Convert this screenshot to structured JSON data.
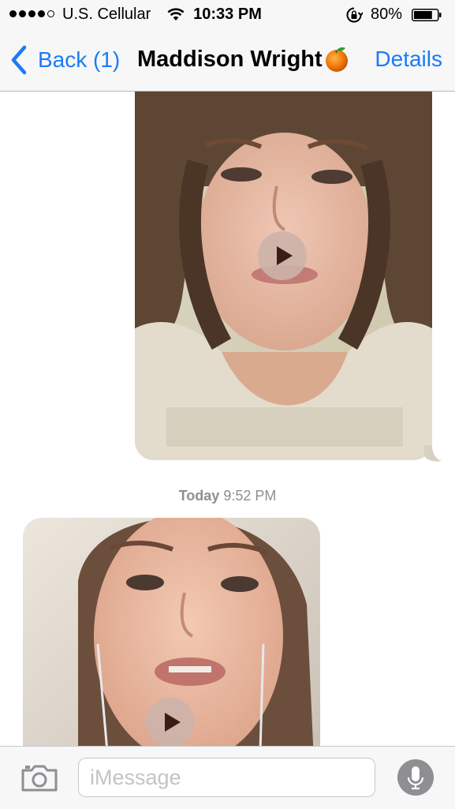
{
  "status_bar": {
    "carrier": "U.S. Cellular",
    "time": "10:33 PM",
    "battery_percent": "80%",
    "battery_level": 0.8,
    "signal_bars_filled": 4,
    "signal_bars_total": 5
  },
  "nav": {
    "back_label": "Back (1)",
    "title": "Maddison Wright",
    "details_label": "Details"
  },
  "messages": [
    {
      "type": "video",
      "direction": "outgoing",
      "icon": "play-icon"
    },
    {
      "type": "video",
      "direction": "incoming",
      "icon": "play-icon"
    }
  ],
  "timestamp": {
    "day": "Today",
    "time": "9:52 PM"
  },
  "input": {
    "placeholder": "iMessage",
    "value": ""
  },
  "colors": {
    "accent": "#1a7cf6",
    "bar_background": "#f7f7f8"
  }
}
